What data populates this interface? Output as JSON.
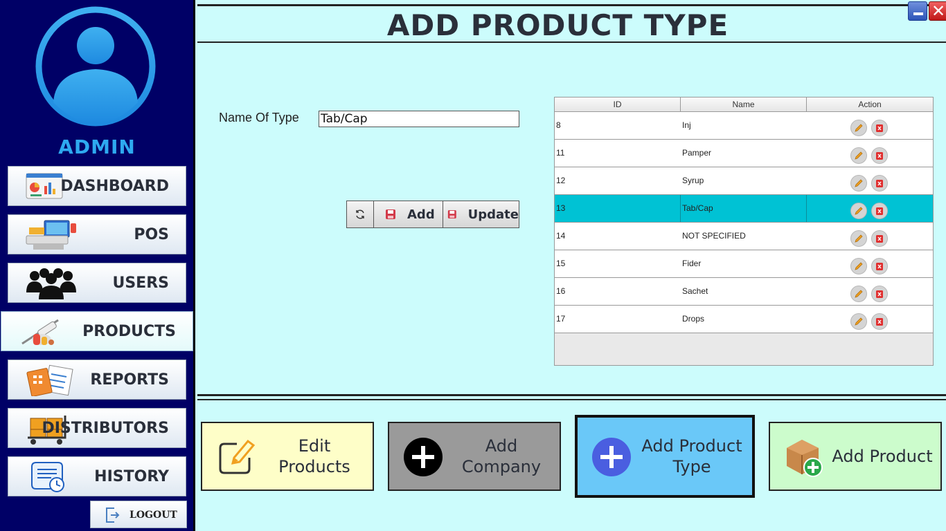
{
  "sidebar": {
    "user_label": "ADMIN",
    "items": [
      {
        "label": "DASHBOARD",
        "icon": "dashboard-icon"
      },
      {
        "label": "POS",
        "icon": "pos-terminal-icon"
      },
      {
        "label": "USERS",
        "icon": "users-group-icon"
      },
      {
        "label": "PRODUCTS",
        "icon": "medicine-products-icon",
        "active": true
      },
      {
        "label": "REPORTS",
        "icon": "reports-calculator-icon"
      },
      {
        "label": "DISTRIBUTORS",
        "icon": "distributor-cart-icon"
      },
      {
        "label": "HISTORY",
        "icon": "history-clock-icon"
      }
    ],
    "logout_label": "LOGOUT"
  },
  "header": {
    "title": "ADD PRODUCT TYPE"
  },
  "form": {
    "name_label": "Name Of Type",
    "name_value": "Tab/Cap"
  },
  "toolbar": {
    "refresh_icon": "refresh-icon",
    "add_label": "Add",
    "update_label": "Update"
  },
  "table": {
    "columns": [
      "ID",
      "Name",
      "Action"
    ],
    "rows": [
      {
        "id": "8",
        "name": "Inj"
      },
      {
        "id": "11",
        "name": "Pamper"
      },
      {
        "id": "12",
        "name": "Syrup"
      },
      {
        "id": "13",
        "name": "Tab/Cap",
        "selected": true
      },
      {
        "id": "14",
        "name": "NOT SPECIFIED"
      },
      {
        "id": "15",
        "name": "Fider"
      },
      {
        "id": "16",
        "name": "Sachet"
      },
      {
        "id": "17",
        "name": "Drops"
      }
    ]
  },
  "bottom_nav": {
    "edit_products": "Edit Products",
    "add_company": "Add Company",
    "add_product_type_line1": "Add Product",
    "add_product_type_line2": "Type",
    "add_product": "Add Product"
  },
  "colors": {
    "sidebar_bg": "#000066",
    "main_bg": "#ccfcfc",
    "selected_row": "#00c2d4",
    "admin_text": "#2eaaf0"
  }
}
